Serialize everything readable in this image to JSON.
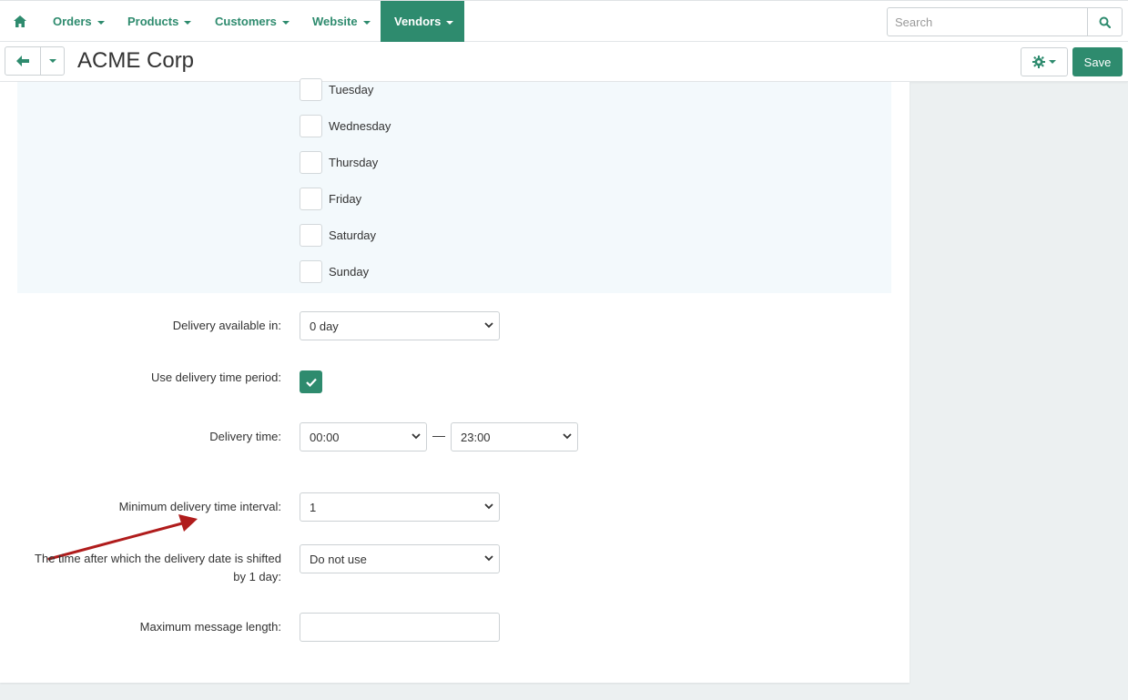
{
  "navbar": {
    "home_icon": "home-icon",
    "items": [
      {
        "label": "Orders"
      },
      {
        "label": "Products"
      },
      {
        "label": "Customers"
      },
      {
        "label": "Website"
      },
      {
        "label": "Vendors",
        "active": true
      }
    ],
    "search_placeholder": "Search",
    "search_icon": "search-icon"
  },
  "header": {
    "title": "ACME Corp",
    "save_label": "Save",
    "back_icon": "arrow-left-icon",
    "gear_icon": "gear-icon"
  },
  "days": [
    "Tuesday",
    "Wednesday",
    "Thursday",
    "Friday",
    "Saturday",
    "Sunday"
  ],
  "form": {
    "delivery_available_label": "Delivery available in:",
    "delivery_available_value": "0 day",
    "use_period_label": "Use delivery time period:",
    "use_period_checked": true,
    "delivery_time_label": "Delivery time:",
    "delivery_time_from": "00:00",
    "delivery_time_separator": "—",
    "delivery_time_to": "23:00",
    "min_interval_label": "Minimum delivery time interval:",
    "min_interval_value": "1",
    "shift_label_line1": "The time after which the delivery date is shifted",
    "shift_label_line2": "by 1 day:",
    "shift_value": "Do not use",
    "max_message_label": "Maximum message length:",
    "max_message_value": ""
  },
  "colors": {
    "accent": "#2e8b6e",
    "annotation_arrow": "#b01c1c",
    "days_background": "#f3f9fc"
  }
}
